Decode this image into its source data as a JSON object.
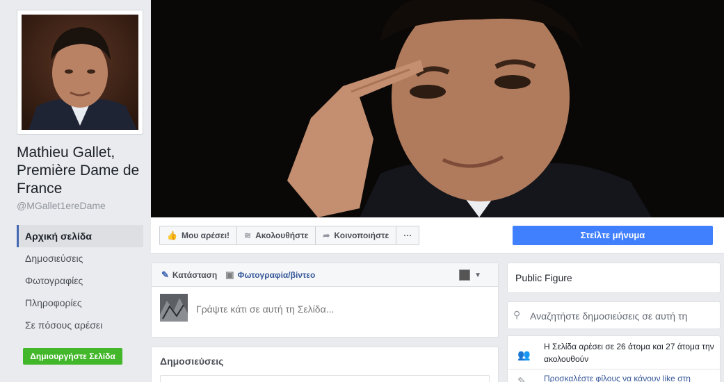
{
  "page": {
    "name": "Mathieu Gallet, Première Dame de France",
    "handle": "@MGallet1ereDame"
  },
  "nav": {
    "items": [
      {
        "label": "Αρχική σελίδα",
        "active": true
      },
      {
        "label": "Δημοσιεύσεις",
        "active": false
      },
      {
        "label": "Φωτογραφίες",
        "active": false
      },
      {
        "label": "Πληροφορίες",
        "active": false
      },
      {
        "label": "Σε πόσους αρέσει",
        "active": false
      }
    ],
    "create_page_label": "Δημιουργήστε Σελίδα"
  },
  "actions": {
    "like_label": "Μου αρέσει!",
    "follow_label": "Ακολουθήστε",
    "share_label": "Κοινοποιήστε",
    "more_label": "···",
    "message_label": "Στείλτε μήνυμα"
  },
  "composer": {
    "status_label": "Κατάσταση",
    "photo_label": "Φωτογραφία/βίντεο",
    "placeholder": "Γράψτε κάτι σε αυτή τη Σελίδα..."
  },
  "posts": {
    "title": "Δημοσιεύσεις"
  },
  "sidebar_right": {
    "category": "Public Figure",
    "search_placeholder": "Αναζητήστε δημοσιεύσεις σε αυτή τη",
    "likes_text": "Η Σελίδα αρέσει σε 26 άτομα και 27 άτομα την ακολουθούν",
    "invite_text": "Προσκαλέστε φίλους να κάνουν like στη"
  },
  "icons": {
    "like": "thumbs-up-icon",
    "follow": "rss-icon",
    "share": "share-arrow-icon",
    "status": "pencil-icon",
    "photo": "camera-icon",
    "search": "search-icon",
    "people": "people-icon"
  },
  "colors": {
    "accent": "#4080ff",
    "create_button": "#42b72a",
    "link": "#365899"
  }
}
